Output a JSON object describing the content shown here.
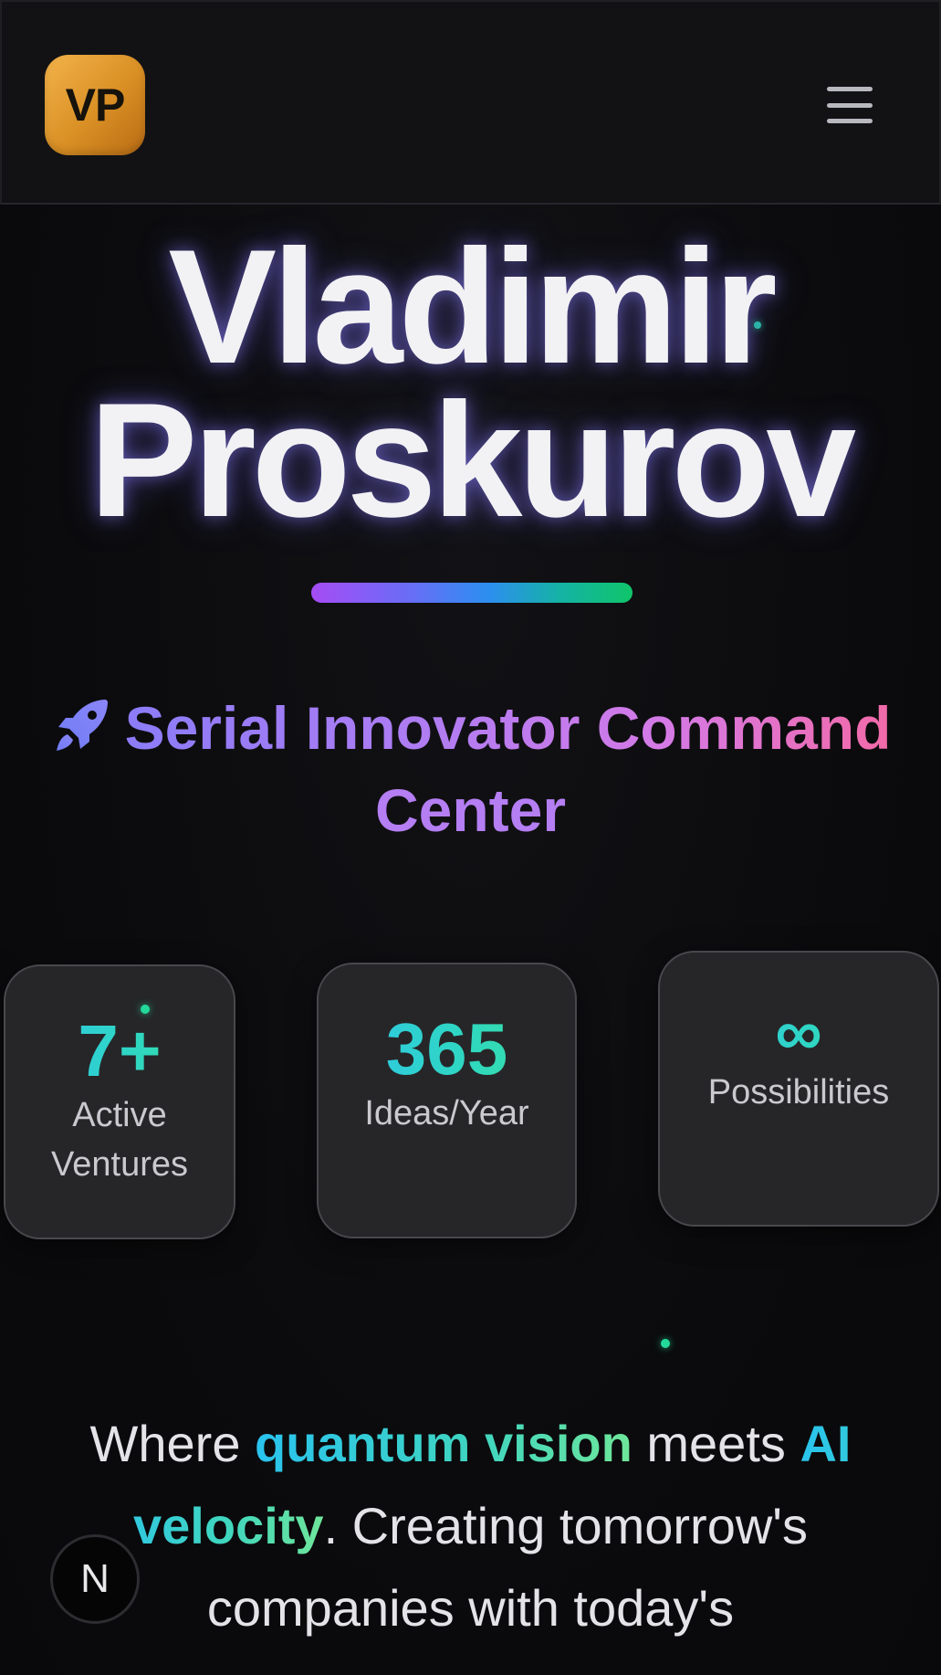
{
  "header": {
    "logo_text": "VP",
    "menu_icon": "hamburger-menu-icon"
  },
  "hero": {
    "name_line1": "Vladimir",
    "name_line2": "Proskurov"
  },
  "subtitle": {
    "icon": "rocket-icon",
    "line1": "Serial Innovator Command",
    "line2": "Center"
  },
  "stats": [
    {
      "value": "7+",
      "label_line1": "Active",
      "label_line2": "Ventures"
    },
    {
      "value": "365",
      "label_line1": "Ideas/Year",
      "label_line2": ""
    },
    {
      "value": "∞",
      "label_line1": "Possibilities",
      "label_line2": ""
    }
  ],
  "tagline": {
    "part1": "Where ",
    "highlight1": "quantum vision",
    "part2": " meets ",
    "highlight2": "AI velocity",
    "part3": ". Creating tomorrow's companies with today's"
  },
  "dev_badge": {
    "glyph": "N",
    "icon": "nextjs-logo-icon"
  },
  "colors": {
    "accent_gold": "#e9a63a",
    "accent_teal": "#2fd6c3",
    "accent_purple": "#b07cf2",
    "accent_pink": "#f26aa8"
  }
}
